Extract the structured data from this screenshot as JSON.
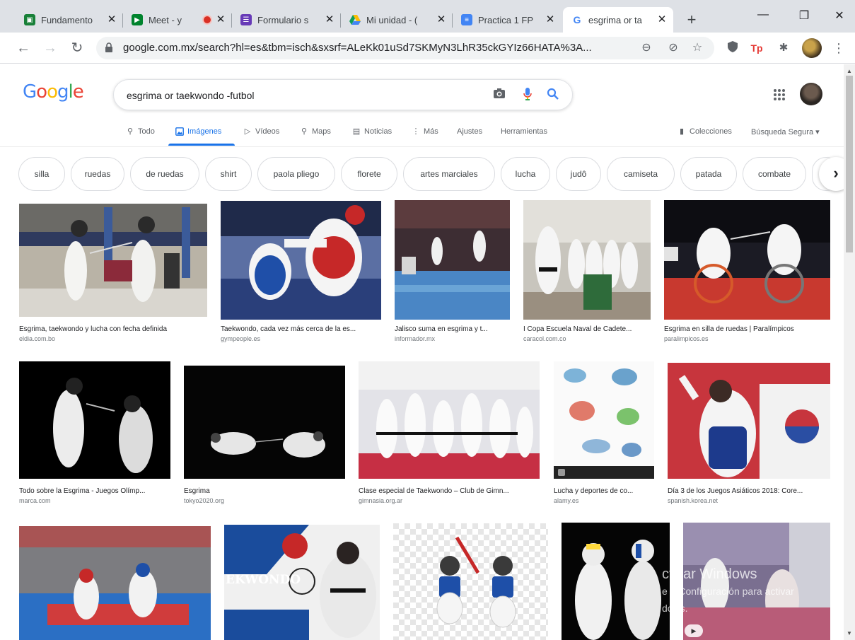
{
  "browser": {
    "tabs": [
      {
        "title": "Fundamento",
        "icon": "classroom-icon",
        "color": "#188038"
      },
      {
        "title": "Meet - y",
        "icon": "meet-icon",
        "color": "#00832d"
      },
      {
        "title": "Formulario s",
        "icon": "forms-icon",
        "color": "#673ab7"
      },
      {
        "title": "Mi unidad - (",
        "icon": "drive-icon",
        "color": "#fbbc04"
      },
      {
        "title": "Practica 1 FP",
        "icon": "docs-icon",
        "color": "#4285f4"
      },
      {
        "title": "esgrima or ta",
        "icon": "google-icon",
        "color": "#4285f4"
      }
    ],
    "new_tab": "+",
    "url": "google.com.mx/search?hl=es&tbm=isch&sxsrf=ALeKk01uSd7SKMyN3LhR35ckGYIz66HATA%3A..."
  },
  "google": {
    "logo": "Google",
    "query": "esgrima or taekwondo -futbol",
    "tabs": [
      {
        "label": "Todo",
        "icon": "search-icon"
      },
      {
        "label": "Imágenes",
        "icon": "image-icon"
      },
      {
        "label": "Vídeos",
        "icon": "video-icon"
      },
      {
        "label": "Maps",
        "icon": "map-pin-icon"
      },
      {
        "label": "Noticias",
        "icon": "news-icon"
      },
      {
        "label": "Más",
        "icon": "more-vert-icon"
      },
      {
        "label": "Ajustes"
      },
      {
        "label": "Herramientas"
      }
    ],
    "collections": "Colecciones",
    "safe_search": "Búsqueda Segura ▾"
  },
  "chips": [
    "silla",
    "ruedas",
    "de ruedas",
    "shirt",
    "paola pliego",
    "florete",
    "artes marciales",
    "lucha",
    "judô",
    "camiseta",
    "patada",
    "combate"
  ],
  "results": [
    {
      "caption": "Esgrima, taekwondo y lucha con fecha definida",
      "source": "eldia.com.bo"
    },
    {
      "caption": "Taekwondo, cada vez más cerca de la es...",
      "source": "gympeople.es"
    },
    {
      "caption": "Jalisco suma en esgrima y t...",
      "source": "informador.mx"
    },
    {
      "caption": "I Copa Escuela Naval de Cadete...",
      "source": "caracol.com.co"
    },
    {
      "caption": "Esgrima en silla de ruedas | Paralímpicos",
      "source": "paralimpicos.es"
    },
    {
      "caption": "Todo sobre la Esgrima - Juegos Olímp...",
      "source": "marca.com"
    },
    {
      "caption": "Esgrima",
      "source": "tokyo2020.org"
    },
    {
      "caption": "Clase especial de Taekwondo – Club de Gimn...",
      "source": "gimnasia.org.ar"
    },
    {
      "caption": "Lucha y deportes de co...",
      "source": "alamy.es"
    },
    {
      "caption": "Día 3 de los Juegos Asiáticos 2018: Core...",
      "source": "spanish.korea.net"
    },
    {
      "caption": "",
      "source": ""
    },
    {
      "caption": "",
      "source": ""
    },
    {
      "caption": "",
      "source": ""
    },
    {
      "caption": "",
      "source": ""
    },
    {
      "caption": "",
      "source": ""
    }
  ],
  "image_text": {
    "taekwondo_banner": "EKWONDO"
  },
  "watermark": {
    "line1": "ctivar Windows",
    "line2": "e a Configuración para activar",
    "line3": "dows."
  },
  "colors": {
    "accent": "#1a73e8",
    "tab_bg": "#dee1e6"
  }
}
